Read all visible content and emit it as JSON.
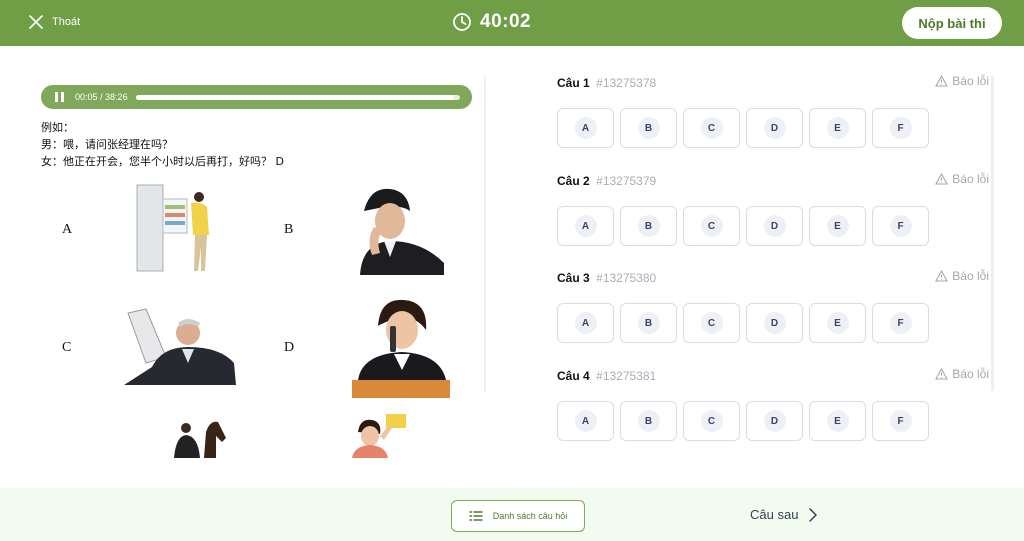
{
  "header": {
    "exit_label": "Thoát",
    "timer": "40:02",
    "submit_label": "Nộp bài thi",
    "accent_color": "#6f9e46"
  },
  "audio": {
    "elapsed": "00:05",
    "separator": " / ",
    "duration": "38:26",
    "progress_fraction": 0.98
  },
  "example": {
    "lines": [
      "例如：",
      "男：喂，请问张经理在吗？",
      "女：他正在开会，您半个小时以后再打，好吗？ D"
    ]
  },
  "options": [
    "A",
    "B",
    "C",
    "D"
  ],
  "questions": [
    {
      "label": "Câu 1",
      "id": "#13275378",
      "report": "Báo lỗi",
      "choices": [
        "A",
        "B",
        "C",
        "D",
        "E",
        "F"
      ]
    },
    {
      "label": "Câu 2",
      "id": "#13275379",
      "report": "Báo lỗi",
      "choices": [
        "A",
        "B",
        "C",
        "D",
        "E",
        "F"
      ]
    },
    {
      "label": "Câu 3",
      "id": "#13275380",
      "report": "Báo lỗi",
      "choices": [
        "A",
        "B",
        "C",
        "D",
        "E",
        "F"
      ]
    },
    {
      "label": "Câu 4",
      "id": "#13275381",
      "report": "Báo lỗi",
      "choices": [
        "A",
        "B",
        "C",
        "D",
        "E",
        "F"
      ]
    }
  ],
  "footer": {
    "list_label": "Danh sách câu hỏi",
    "next_label": "Câu sau"
  }
}
